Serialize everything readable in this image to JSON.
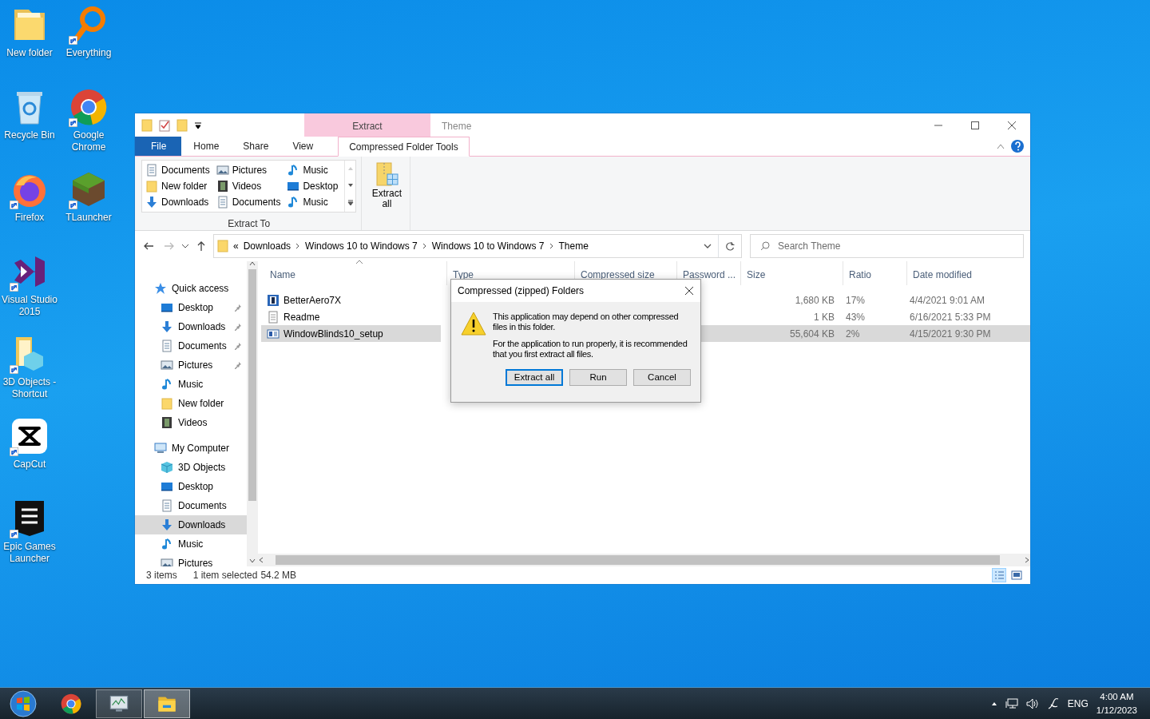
{
  "desktop_icons": [
    {
      "label": "New folder",
      "kind": "folder",
      "shortcut": false
    },
    {
      "label": "Everything",
      "kind": "magnifier",
      "shortcut": true
    },
    {
      "label": "Recycle Bin",
      "kind": "bin",
      "shortcut": false
    },
    {
      "label": "Google Chrome",
      "kind": "chrome",
      "shortcut": true
    },
    {
      "label": "Firefox",
      "kind": "firefox",
      "shortcut": true
    },
    {
      "label": "TLauncher",
      "kind": "block",
      "shortcut": true
    },
    {
      "label": "Visual Studio 2015",
      "kind": "vs",
      "shortcut": true
    },
    {
      "label": "3D Objects - Shortcut",
      "kind": "folder3d",
      "shortcut": true
    },
    {
      "label": "CapCut",
      "kind": "capcut",
      "shortcut": true
    },
    {
      "label": "Epic Games Launcher",
      "kind": "epic",
      "shortcut": true
    }
  ],
  "window": {
    "title": "Theme",
    "context_tab_header": "Extract",
    "ribbon_tabs": [
      {
        "label": "File",
        "kind": "file",
        "selected": false
      },
      {
        "label": "Home",
        "kind": "tab",
        "selected": false
      },
      {
        "label": "Share",
        "kind": "tab",
        "selected": false
      },
      {
        "label": "View",
        "kind": "tab",
        "selected": false
      },
      {
        "label": "Compressed Folder Tools",
        "kind": "context",
        "selected": true
      }
    ],
    "extract_to": {
      "label": "Extract To",
      "items": [
        {
          "label": "Documents",
          "kind": "document"
        },
        {
          "label": "Pictures",
          "kind": "picture"
        },
        {
          "label": "Music",
          "kind": "music"
        },
        {
          "label": "New folder",
          "kind": "folder"
        },
        {
          "label": "Videos",
          "kind": "video"
        },
        {
          "label": "Desktop",
          "kind": "desktop"
        },
        {
          "label": "Downloads",
          "kind": "download"
        },
        {
          "label": "Documents",
          "kind": "document"
        },
        {
          "label": "Music",
          "kind": "music"
        }
      ]
    },
    "extract_all_button": "Extract all",
    "address_bar": {
      "overflow": "«",
      "crumbs": [
        "Downloads",
        "Windows 10 to Windows 7",
        "Windows 10 to Windows 7",
        "Theme"
      ]
    },
    "search": {
      "placeholder": "Search Theme"
    },
    "navigation": [
      {
        "label": "Quick access",
        "kind": "star",
        "selected": false,
        "children": [
          {
            "label": "Desktop",
            "kind": "desktop",
            "pinned": true,
            "selected": false
          },
          {
            "label": "Downloads",
            "kind": "download",
            "pinned": true,
            "selected": false
          },
          {
            "label": "Documents",
            "kind": "document",
            "pinned": true,
            "selected": false
          },
          {
            "label": "Pictures",
            "kind": "picture",
            "pinned": true,
            "selected": false
          },
          {
            "label": "Music",
            "kind": "music",
            "pinned": false,
            "selected": false
          },
          {
            "label": "New folder",
            "kind": "folder",
            "pinned": false,
            "selected": false
          },
          {
            "label": "Videos",
            "kind": "video",
            "pinned": false,
            "selected": false
          }
        ]
      },
      {
        "label": "My Computer",
        "kind": "computer",
        "selected": false,
        "children": [
          {
            "label": "3D Objects",
            "kind": "cube",
            "pinned": false,
            "selected": false
          },
          {
            "label": "Desktop",
            "kind": "desktop",
            "pinned": false,
            "selected": false
          },
          {
            "label": "Documents",
            "kind": "document",
            "pinned": false,
            "selected": false
          },
          {
            "label": "Downloads",
            "kind": "download",
            "pinned": false,
            "selected": true
          },
          {
            "label": "Music",
            "kind": "music",
            "pinned": false,
            "selected": false
          },
          {
            "label": "Pictures",
            "kind": "picture",
            "pinned": false,
            "selected": false
          }
        ]
      }
    ],
    "columns": [
      {
        "label": "Name",
        "sorted": true
      },
      {
        "label": "Type",
        "sorted": false
      },
      {
        "label": "Compressed size",
        "sorted": false
      },
      {
        "label": "Password ...",
        "sorted": false
      },
      {
        "label": "Size",
        "sorted": false
      },
      {
        "label": "Ratio",
        "sorted": false
      },
      {
        "label": "Date modified",
        "sorted": false
      }
    ],
    "rows": [
      {
        "name": "BetterAero7X",
        "kind": "app",
        "size": "1,680 KB",
        "ratio": "17%",
        "date_modified": "4/4/2021 9:01 AM",
        "selected": false
      },
      {
        "name": "Readme",
        "kind": "text",
        "size": "1 KB",
        "ratio": "43%",
        "date_modified": "6/16/2021 5:33 PM",
        "selected": false
      },
      {
        "name": "WindowBlinds10_setup",
        "kind": "setup",
        "size": "55,604 KB",
        "ratio": "2%",
        "date_modified": "4/15/2021 9:30 PM",
        "selected": true
      }
    ],
    "status_bar": {
      "item_count": "3 items",
      "selection": "1 item selected",
      "selection_size": "54.2 MB"
    },
    "dialog": {
      "title": "Compressed (zipped) Folders",
      "message": "This application may depend on other compressed files in this folder.",
      "recommendation": "For the application to run properly, it is recommended that you first extract all files.",
      "buttons": [
        {
          "label": "Extract all",
          "default": true
        },
        {
          "label": "Run",
          "default": false
        },
        {
          "label": "Cancel",
          "default": false
        }
      ]
    }
  },
  "taskbar": {
    "apps": [
      {
        "kind": "chrome",
        "running": false,
        "active": false
      },
      {
        "kind": "monitor",
        "running": true,
        "active": false
      },
      {
        "kind": "explorer",
        "running": true,
        "active": true
      }
    ],
    "language": "ENG",
    "time": "4:00 AM",
    "date": "1/12/2023"
  }
}
